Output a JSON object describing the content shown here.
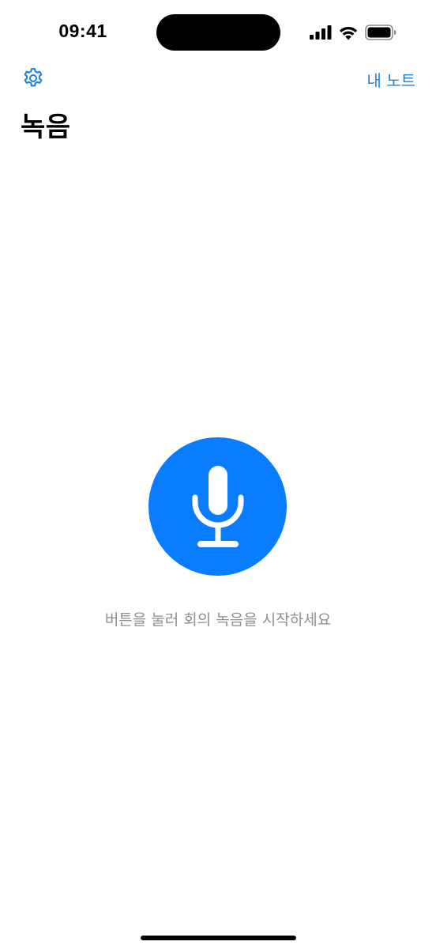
{
  "status_bar": {
    "time": "09:41"
  },
  "nav": {
    "notes_label": "내 노트",
    "settings_icon": "gear-icon"
  },
  "page": {
    "title": "녹음"
  },
  "record": {
    "icon": "microphone-icon",
    "hint": "버튼을 눌러 회의 녹음을 시작하세요"
  },
  "colors": {
    "accent": "#0a7cff",
    "link": "#1b7fe0",
    "hint": "#8e8e93"
  }
}
